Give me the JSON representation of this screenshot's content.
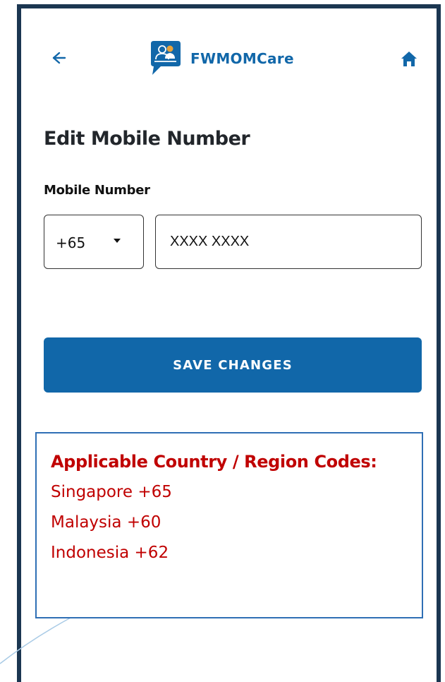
{
  "header": {
    "app_name": "FWMOMCare",
    "back_icon": "arrow-left-icon",
    "home_icon": "home-icon",
    "logo_icon": "chat-people-logo"
  },
  "page": {
    "title": "Edit Mobile Number"
  },
  "form": {
    "mobile_label": "Mobile Number",
    "country_code": "+65",
    "mobile_value": "XXXX XXXX",
    "save_label": "SAVE CHANGES"
  },
  "note": {
    "title": "Applicable Country / Region Codes:",
    "items": [
      "Singapore +65",
      "Malaysia +60",
      "Indonesia +62"
    ]
  },
  "colors": {
    "brand_blue": "#1167a9",
    "frame_navy": "#1b3651",
    "note_red": "#c00000",
    "note_border": "#2f6fb5"
  }
}
